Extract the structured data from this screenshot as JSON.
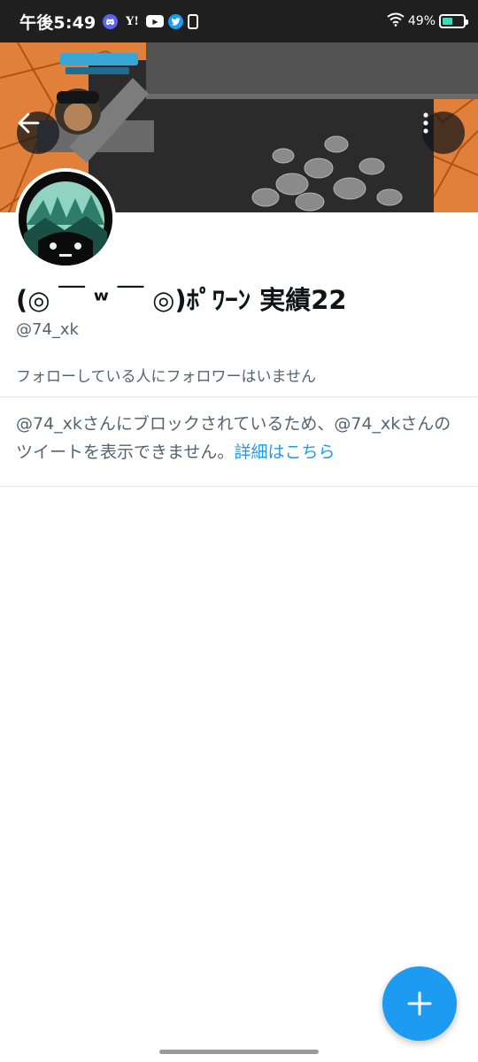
{
  "status_bar": {
    "time": "午後5:49",
    "battery_text": "49%",
    "battery_level": 0.49,
    "battery_color": "#3ddbb9",
    "icons": [
      "discord-icon",
      "yahoo-icon",
      "youtube-icon",
      "twitter-icon",
      "notification-icon",
      "wifi-icon",
      "battery-icon"
    ]
  },
  "header": {
    "back_icon": "arrow-left-icon",
    "more_icon": "more-vertical-icon"
  },
  "profile": {
    "display_name": "(◎ ￣ ʷ ￣ ◎)ﾎﾟﾜｰﾝ 実績22",
    "handle": "@74_xk",
    "followed_note": "フォローしている人にフォロワーはいません"
  },
  "blocked": {
    "message": "@74_xkさんにブロックされているため、@74_xkさんのツイートを表示できません。",
    "link": "詳細はこちら"
  },
  "fab": {
    "icon": "plus-icon",
    "color": "#1d9bf0"
  },
  "colors": {
    "accent": "#1d9bf0",
    "secondary_text": "#536471",
    "primary_text": "#0f1419",
    "banner_orange": "#e0803a"
  }
}
